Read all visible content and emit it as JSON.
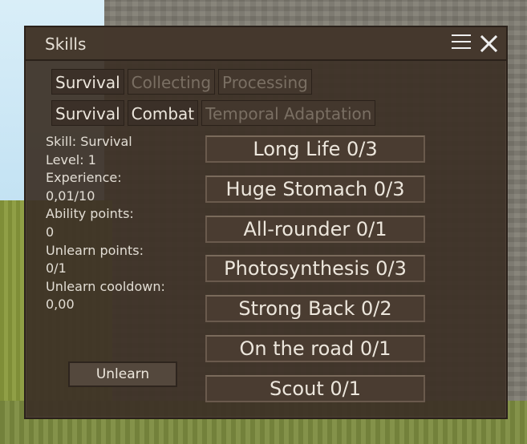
{
  "window": {
    "title": "Skills"
  },
  "tabs_row1": [
    {
      "label": "Survival",
      "active": true
    },
    {
      "label": "Collecting",
      "active": false
    },
    {
      "label": "Processing",
      "active": false
    }
  ],
  "tabs_row2": [
    {
      "label": "Survival",
      "active": true
    },
    {
      "label": "Combat",
      "active": true
    },
    {
      "label": "Temporal Adaptation",
      "active": false
    }
  ],
  "info": {
    "skill": "Skill: Survival",
    "level": "Level: 1",
    "experience_label": "Experience:",
    "experience_value": "0,01/10",
    "ability_points_label": "Ability points:",
    "ability_points_value": "0",
    "unlearn_points_label": "Unlearn points:",
    "unlearn_points_value": "0/1",
    "unlearn_cooldown_label": "Unlearn cooldown:",
    "unlearn_cooldown_value": "0,00"
  },
  "unlearn_button": "Unlearn",
  "abilities": [
    "Long Life 0/3",
    "Huge Stomach 0/3",
    "All-rounder 0/1",
    "Photosynthesis 0/3",
    "Strong Back 0/2",
    "On the road 0/1",
    "Scout 0/1"
  ],
  "icons": {
    "menu": "menu-icon",
    "close": "close-icon"
  }
}
